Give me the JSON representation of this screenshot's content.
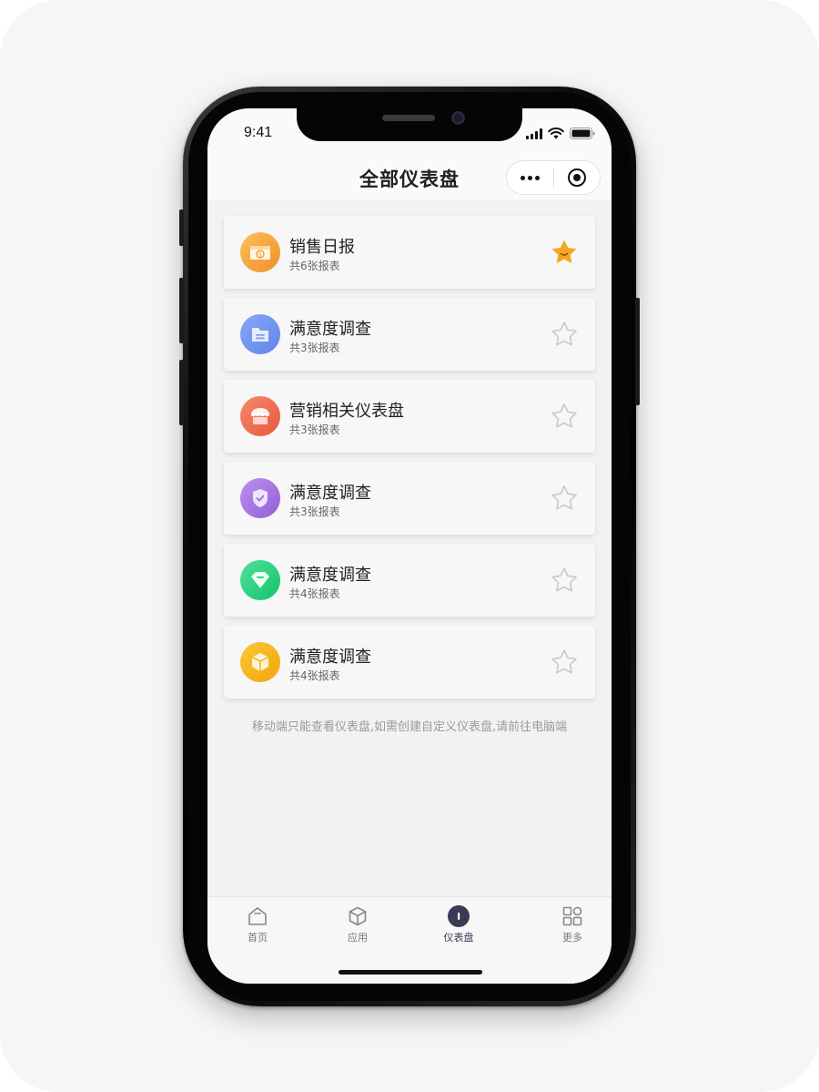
{
  "status_bar": {
    "time": "9:41"
  },
  "header": {
    "title": "全部仪表盘"
  },
  "dashboards": [
    {
      "title": "销售日报",
      "subtitle": "共6张报表",
      "icon": "money-icon",
      "color": "#f7a23c",
      "favorited": true
    },
    {
      "title": "满意度调查",
      "subtitle": "共3张报表",
      "icon": "folder-icon",
      "color": "#6a8ff0",
      "favorited": false
    },
    {
      "title": "营销相关仪表盘",
      "subtitle": "共3张报表",
      "icon": "shop-icon",
      "color": "#ee6a55",
      "favorited": false
    },
    {
      "title": "满意度调查",
      "subtitle": "共3张报表",
      "icon": "shield-icon",
      "color": "#a06ad8",
      "favorited": false
    },
    {
      "title": "满意度调查",
      "subtitle": "共4张报表",
      "icon": "diamond-icon",
      "color": "#22cc77",
      "favorited": false
    },
    {
      "title": "满意度调查",
      "subtitle": "共4张报表",
      "icon": "box-icon",
      "color": "#f4b010",
      "favorited": false
    }
  ],
  "footnote": "移动端只能查看仪表盘,如需创建自定义仪表盘,请前往电脑端",
  "tabbar": [
    {
      "label": "首页",
      "icon": "home-icon",
      "active": false
    },
    {
      "label": "应用",
      "icon": "cube-icon",
      "active": false
    },
    {
      "label": "仪表盘",
      "icon": "gauge-icon",
      "active": true
    },
    {
      "label": "更多",
      "icon": "grid-icon",
      "active": false
    }
  ],
  "colors": {
    "star_active": "#f5a623",
    "star_inactive": "#c8c8c8",
    "tab_active": "#3a3a55"
  }
}
